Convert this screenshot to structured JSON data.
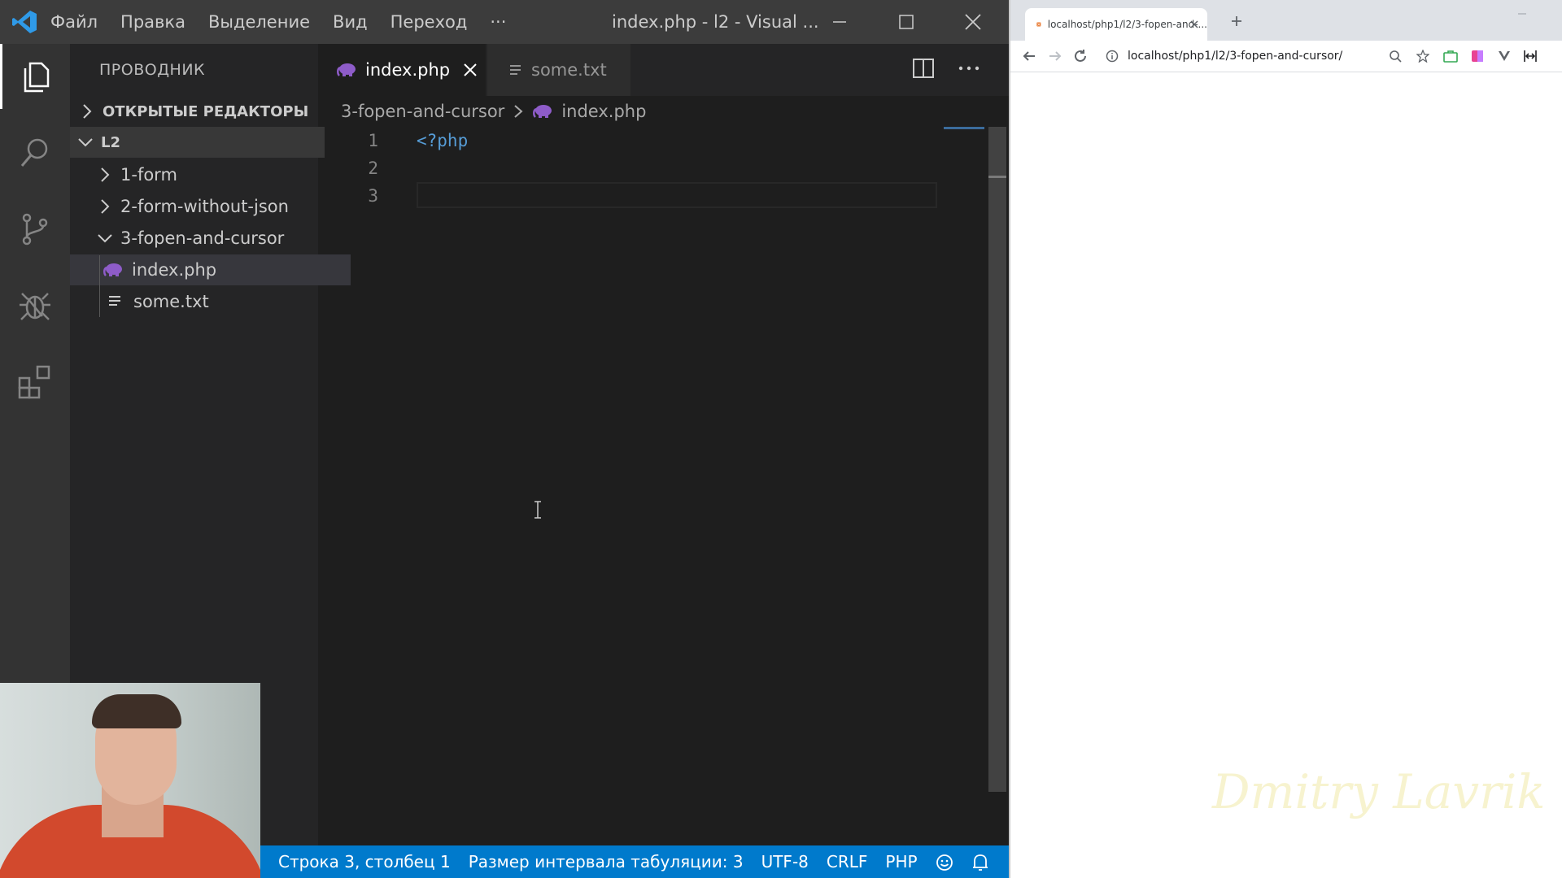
{
  "vscode": {
    "menu": [
      "Файл",
      "Правка",
      "Выделение",
      "Вид",
      "Переход",
      "···"
    ],
    "window_title": "index.php - l2 - Visual ...",
    "explorer_title": "ПРОВОДНИК",
    "tree": {
      "open_editors": "ОТКРЫТЫЕ РЕДАКТОРЫ",
      "root": "L2",
      "folders": [
        "1-form",
        "2-form-without-json",
        "3-fopen-and-cursor"
      ],
      "files": [
        "index.php",
        "some.txt"
      ]
    },
    "tabs": [
      {
        "label": "index.php"
      },
      {
        "label": "some.txt"
      }
    ],
    "breadcrumb": {
      "folder": "3-fopen-and-cursor",
      "file": "index.php"
    },
    "line_numbers": [
      "1",
      "2",
      "3"
    ],
    "code": [
      "<?php",
      "",
      ""
    ],
    "status": {
      "position": "Строка 3, столбец 1",
      "tab_size": "Размер интервала табуляции: 3",
      "encoding": "UTF-8",
      "eol": "CRLF",
      "language": "PHP"
    },
    "colors": {
      "accent": "#007acc",
      "php_icon": "#8e5cc9",
      "keyword": "#569cd6"
    }
  },
  "browser": {
    "tab_title": "localhost/php1/l2/3-fopen-and-...",
    "url": "localhost/php1/l2/3-fopen-and-cursor/",
    "watermark": "Dmitry Lavrik"
  }
}
